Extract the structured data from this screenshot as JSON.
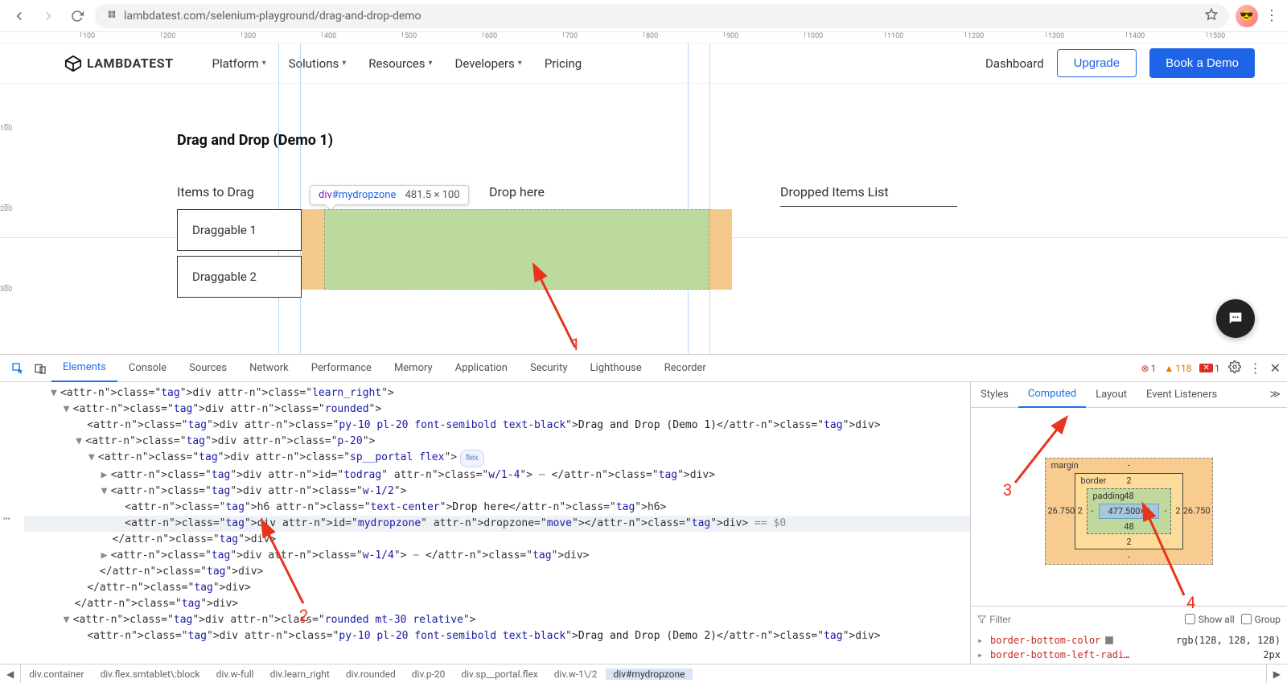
{
  "browser": {
    "url": "lambdatest.com/selenium-playground/drag-and-drop-demo",
    "avatar": "😎"
  },
  "ruler": {
    "h": [
      "100",
      "200",
      "300",
      "400",
      "500",
      "600",
      "700",
      "800",
      "900",
      "1000",
      "1100",
      "1200",
      "1300",
      "1400",
      "1500"
    ],
    "v": [
      "100",
      "200",
      "300"
    ]
  },
  "header": {
    "brand": "LAMBDATEST",
    "nav": {
      "platform": "Platform",
      "solutions": "Solutions",
      "resources": "Resources",
      "developers": "Developers",
      "pricing": "Pricing"
    },
    "dashboard": "Dashboard",
    "upgrade": "Upgrade",
    "book": "Book a Demo"
  },
  "demo": {
    "title": "Drag and Drop (Demo 1)",
    "items_heading": "Items to Drag",
    "drag1": "Draggable 1",
    "drag2": "Draggable 2",
    "drop_heading": "Drop here",
    "dropped_heading": "Dropped Items List",
    "tooltip_sel": "div",
    "tooltip_id": "#mydropzone",
    "tooltip_dims": "481.5 × 100"
  },
  "annotations": {
    "n1": "1",
    "n2": "2",
    "n3": "3",
    "n4": "4"
  },
  "devtools": {
    "tabs": {
      "elements": "Elements",
      "console": "Console",
      "sources": "Sources",
      "network": "Network",
      "performance": "Performance",
      "memory": "Memory",
      "application": "Application",
      "security": "Security",
      "lighthouse": "Lighthouse",
      "recorder": "Recorder"
    },
    "errors": {
      "red": "1",
      "orange": "118",
      "blue": "1"
    },
    "dom": {
      "l1": "<div class=\"learn_right\">",
      "l2": "<div class=\"rounded\">",
      "l3a": "<div class=\"py-10 pl-20 font-semibold text-black\">",
      "l3t": "Drag and Drop (Demo 1)",
      "l3c": "</div>",
      "l4": "<div class=\"p-20\">",
      "l5": "<div class=\"sp__portal flex\">",
      "l5_pill": "flex",
      "l6a": "<div id=\"todrag\" class=\"w/1-4\">",
      "l6c": "</div>",
      "l7": "<div class=\"w-1/2\">",
      "l8a": "<h6 class=\"text-center\">",
      "l8t": "Drop here",
      "l8c": "</h6>",
      "l9a": "<div id=\"mydropzone\" dropzone=\"move\">",
      "l9c": "</div>",
      "l9d": " == $0",
      "l10": "</div>",
      "l11a": "<div class=\"w-1/4\">",
      "l11c": "</div>",
      "l12": "</div>",
      "l13": "</div>",
      "l14": "</div>",
      "l15": "<div class=\"rounded mt-30 relative\">",
      "l16a": "<div class=\"py-10 pl-20 font-semibold text-black\">",
      "l16t": "Drag and Drop (Demo 2)",
      "l16c": "</div>"
    },
    "breadcrumb": [
      "div.container",
      "div.flex.smtablet\\:block",
      "div.w-full",
      "div.learn_right",
      "div.rounded",
      "div.p-20",
      "div.sp__portal.flex",
      "div.w-1\\/2",
      "div#mydropzone"
    ],
    "styles_tabs": {
      "styles": "Styles",
      "computed": "Computed",
      "layout": "Layout",
      "event": "Event Listeners"
    },
    "box": {
      "margin_label": "margin",
      "border_label": "border",
      "padding_label": "padding",
      "m_top": "-",
      "m_right": "26.750",
      "m_bottom": "-",
      "m_left": "26.750",
      "b_top": "2",
      "b_right": "2",
      "b_bottom": "2",
      "b_left": "2",
      "p_top": "48",
      "p_right": "-",
      "p_bottom": "48",
      "p_left": "-",
      "content": "477.500×0"
    },
    "filter": {
      "placeholder": "Filter",
      "showall": "Show all",
      "group": "Group"
    },
    "computed_props": {
      "p1_name": "border-bottom-color",
      "p1_val": "rgb(128, 128, 128)",
      "p2_name": "border-bottom-left-radi…",
      "p2_val": "2px"
    }
  }
}
